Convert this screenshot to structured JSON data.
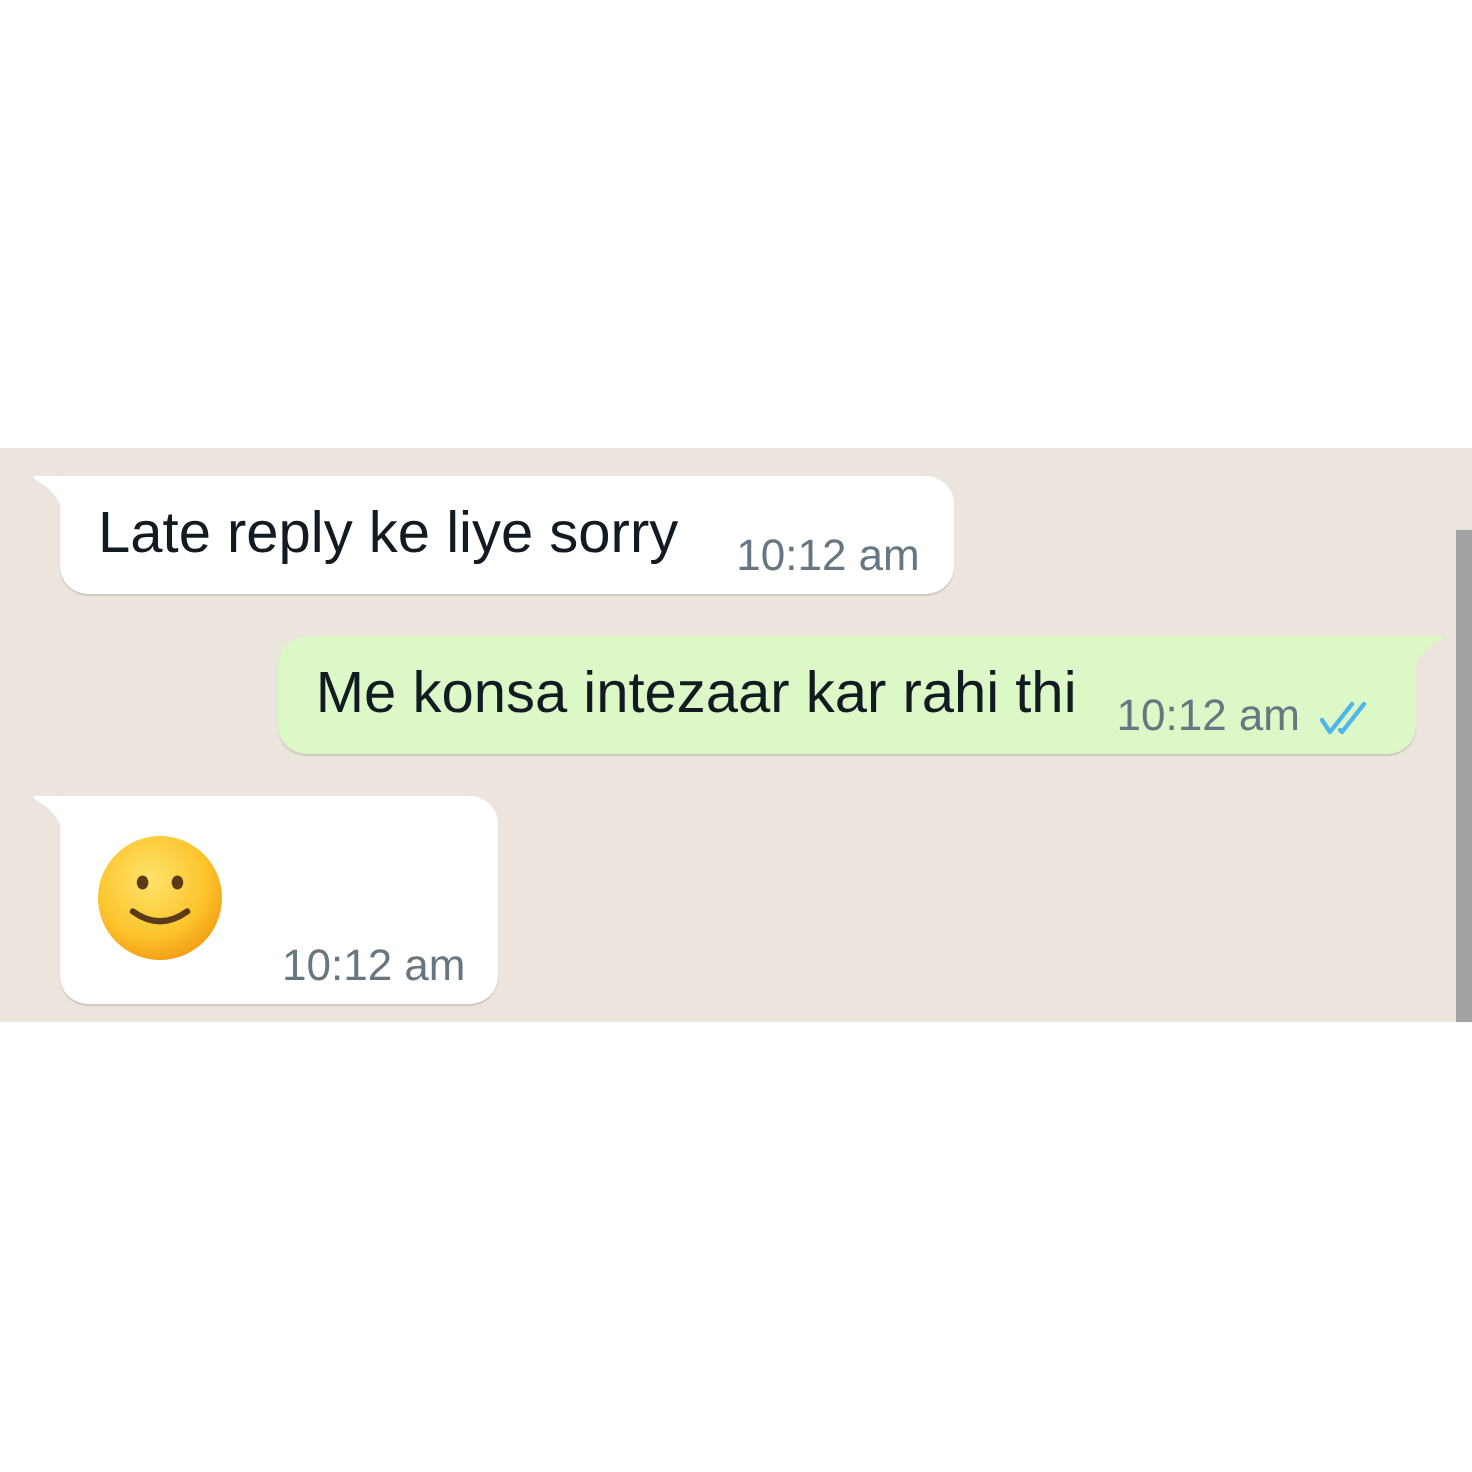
{
  "messages": [
    {
      "kind": "text",
      "outgoing": false,
      "tail": true,
      "text": "Late reply ke liye sorry",
      "time": "10:12 am"
    },
    {
      "kind": "text",
      "outgoing": true,
      "tail": true,
      "text": "Me konsa intezaar kar rahi thi",
      "time": "10:12 am",
      "read": true
    },
    {
      "kind": "emoji",
      "outgoing": false,
      "tail": true,
      "time": "10:12 am"
    }
  ]
}
